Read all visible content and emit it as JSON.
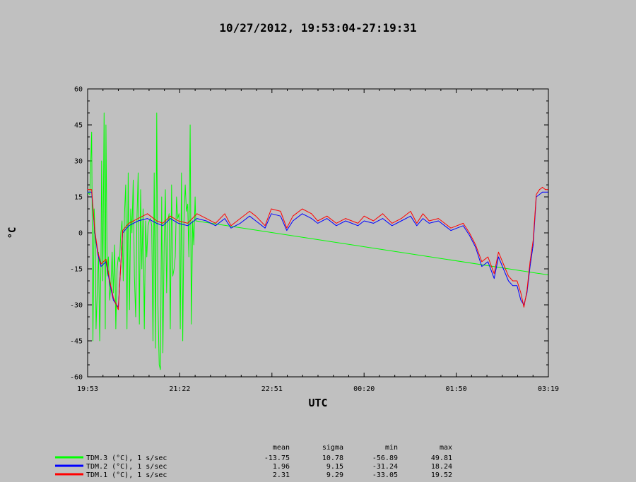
{
  "chart_data": {
    "type": "line",
    "title": "10/27/2012, 19:53:04-27:19:31",
    "xlabel": "UTC",
    "ylabel": "°C",
    "ylim": [
      -60,
      60
    ],
    "y_ticks": [
      "60",
      "45",
      "30",
      "15",
      "0",
      "-15",
      "-30",
      "-45",
      "-60"
    ],
    "x_ticks": [
      "19:53",
      "21:22",
      "22:51",
      "00:20",
      "01:50",
      "03:19"
    ],
    "x_range_hours": [
      19.8844,
      27.3253
    ],
    "grid": false,
    "colors": {
      "TDM.3": "#00ff00",
      "TDM.2": "#0000ff",
      "TDM.1": "#ff0000"
    },
    "stats_headers": [
      "mean",
      "sigma",
      "min",
      "max"
    ],
    "series": [
      {
        "name": "TDM.3 (°C), 1 s/sec",
        "key": "TDM.3",
        "stats": [
          "-13.75",
          "10.78",
          "-56.89",
          "49.81"
        ],
        "x": [
          19.88,
          19.92,
          19.95,
          19.97,
          19.99,
          20.01,
          20.02,
          20.04,
          20.06,
          20.08,
          20.1,
          20.11,
          20.13,
          20.15,
          20.17,
          20.18,
          20.2,
          20.22,
          20.24,
          20.26,
          20.28,
          20.3,
          20.32,
          20.34,
          20.36,
          20.38,
          20.4,
          20.42,
          20.44,
          20.46,
          20.48,
          20.5,
          20.52,
          20.54,
          20.56,
          20.58,
          20.6,
          20.62,
          20.64,
          20.66,
          20.68,
          20.7,
          20.72,
          20.74,
          20.76,
          20.78,
          20.8,
          20.82,
          20.84,
          20.86,
          20.88,
          20.9,
          20.92,
          20.94,
          20.96,
          20.98,
          21.0,
          21.02,
          21.04,
          21.06,
          21.08,
          21.1,
          21.12,
          21.14,
          21.16,
          21.18,
          21.2,
          21.22,
          21.24,
          21.26,
          21.28,
          21.3,
          21.32,
          21.34,
          21.36,
          21.38,
          21.4,
          21.42,
          21.44,
          21.46,
          21.48,
          21.5,
          21.52,
          21.54,
          21.56,
          21.58,
          21.6,
          21.62,
          21.63,
          27.32
        ],
        "y": [
          17,
          16,
          42,
          -45,
          10,
          -5,
          -40,
          -25,
          -8,
          -45,
          -12,
          30,
          -20,
          50,
          -40,
          45,
          -18,
          -10,
          -28,
          -22,
          -8,
          -25,
          -5,
          -40,
          -15,
          -10,
          -12,
          0,
          5,
          -20,
          8,
          20,
          -40,
          25,
          -32,
          10,
          0,
          22,
          -18,
          -35,
          5,
          25,
          -38,
          18,
          -15,
          10,
          -40,
          5,
          -10,
          3,
          5,
          6,
          3,
          -45,
          25,
          -48,
          50,
          -30,
          -55,
          -57,
          15,
          -50,
          -5,
          18,
          -25,
          5,
          8,
          -40,
          20,
          -18,
          -15,
          -10,
          15,
          6,
          8,
          -40,
          25,
          -45,
          5,
          20,
          9,
          12,
          -10,
          45,
          -38,
          5,
          -5,
          15,
          5,
          -17.5
        ],
        "values": [
          17,
          16,
          42,
          -45,
          10,
          -5,
          -40,
          -25,
          -8,
          -45,
          -12,
          30,
          -20,
          50,
          -40,
          45,
          -18,
          -10,
          -28,
          -22,
          -8,
          -25,
          -5,
          -40,
          -15,
          -10,
          -12,
          0,
          5,
          -20,
          8,
          20,
          -40,
          25,
          -32,
          10,
          0,
          22,
          -18,
          -35,
          5,
          25,
          -38,
          18,
          -15,
          10,
          -40,
          5,
          -10,
          3,
          5,
          6,
          3,
          -45,
          25,
          -48,
          50,
          -30,
          -55,
          -57,
          15,
          -50,
          -5,
          18,
          -25,
          5,
          8,
          -40,
          20,
          -18,
          -15,
          -10,
          15,
          6,
          8,
          -40,
          25,
          -45,
          5,
          20,
          9,
          12,
          -10,
          45,
          -38,
          5,
          -5,
          15,
          5,
          -17.5
        ]
      },
      {
        "name": "TDM.2 (°C), 1 s/sec",
        "key": "TDM.2",
        "stats": [
          "1.96",
          "9.15",
          "-31.24",
          "18.24"
        ],
        "x": [
          19.88,
          19.95,
          20.0,
          20.05,
          20.1,
          20.18,
          20.25,
          20.3,
          20.38,
          20.45,
          20.55,
          20.7,
          20.85,
          21.0,
          21.1,
          21.22,
          21.35,
          21.5,
          21.65,
          21.8,
          21.95,
          22.1,
          22.2,
          22.35,
          22.5,
          22.6,
          22.75,
          22.85,
          23.0,
          23.1,
          23.2,
          23.35,
          23.5,
          23.6,
          23.75,
          23.9,
          24.05,
          24.15,
          24.25,
          24.35,
          24.5,
          24.65,
          24.8,
          24.95,
          25.1,
          25.2,
          25.3,
          25.4,
          25.55,
          25.65,
          25.75,
          25.85,
          25.95,
          26.05,
          26.15,
          26.25,
          26.35,
          26.45,
          26.52,
          26.6,
          26.68,
          26.75,
          26.82,
          26.88,
          26.93,
          26.98,
          27.03,
          27.08,
          27.13,
          27.18,
          27.23,
          27.28,
          27.32
        ],
        "y": [
          17,
          17,
          0,
          -9,
          -14,
          -12,
          -22,
          -28,
          -31,
          0,
          3,
          5,
          6,
          4,
          3,
          6,
          4,
          3,
          6,
          5,
          3,
          6,
          2,
          4,
          7,
          5,
          2,
          8,
          7,
          1,
          5,
          8,
          6,
          4,
          6,
          3,
          5,
          4,
          3,
          5,
          4,
          6,
          3,
          5,
          7,
          3,
          6,
          4,
          5,
          3,
          1,
          2,
          3,
          -1,
          -6,
          -14,
          -12,
          -19,
          -10,
          -15,
          -20,
          -22,
          -22,
          -28,
          -30,
          -25,
          -14,
          -5,
          15,
          16,
          17,
          17,
          17
        ],
        "values": [
          17,
          17,
          0,
          -9,
          -14,
          -12,
          -22,
          -28,
          -31,
          0,
          3,
          5,
          6,
          4,
          3,
          6,
          4,
          3,
          6,
          5,
          3,
          6,
          2,
          4,
          7,
          5,
          2,
          8,
          7,
          1,
          5,
          8,
          6,
          4,
          6,
          3,
          5,
          4,
          3,
          5,
          4,
          6,
          3,
          5,
          7,
          3,
          6,
          4,
          5,
          3,
          1,
          2,
          3,
          -1,
          -6,
          -14,
          -12,
          -19,
          -10,
          -15,
          -20,
          -22,
          -22,
          -28,
          -30,
          -25,
          -14,
          -5,
          15,
          16,
          17,
          17,
          17
        ]
      },
      {
        "name": "TDM.1 (°C), 1 s/sec",
        "key": "TDM.1",
        "stats": [
          "2.31",
          "9.29",
          "-33.05",
          "19.52"
        ],
        "x": [
          19.88,
          19.95,
          20.0,
          20.05,
          20.1,
          20.18,
          20.25,
          20.3,
          20.38,
          20.45,
          20.55,
          20.7,
          20.85,
          21.0,
          21.1,
          21.22,
          21.35,
          21.5,
          21.65,
          21.8,
          21.95,
          22.1,
          22.2,
          22.35,
          22.5,
          22.6,
          22.75,
          22.85,
          23.0,
          23.1,
          23.2,
          23.35,
          23.5,
          23.6,
          23.75,
          23.9,
          24.05,
          24.15,
          24.25,
          24.35,
          24.5,
          24.65,
          24.8,
          24.95,
          25.1,
          25.2,
          25.3,
          25.4,
          25.55,
          25.65,
          25.75,
          25.85,
          25.95,
          26.05,
          26.15,
          26.25,
          26.35,
          26.45,
          26.52,
          26.6,
          26.68,
          26.75,
          26.82,
          26.88,
          26.93,
          26.98,
          27.03,
          27.08,
          27.13,
          27.18,
          27.23,
          27.28,
          27.32
        ],
        "y": [
          18,
          18,
          1,
          -8,
          -13,
          -11,
          -21,
          -27,
          -32,
          1,
          4,
          6,
          8,
          5,
          4,
          7,
          5,
          4,
          8,
          6,
          4,
          8,
          3,
          6,
          9,
          7,
          3,
          10,
          9,
          2,
          7,
          10,
          8,
          5,
          7,
          4,
          6,
          5,
          4,
          7,
          5,
          8,
          4,
          6,
          9,
          4,
          8,
          5,
          6,
          4,
          2,
          3,
          4,
          0,
          -5,
          -12,
          -10,
          -17,
          -8,
          -13,
          -18,
          -20,
          -20,
          -25,
          -31,
          -24,
          -12,
          -3,
          16,
          18,
          19,
          18,
          18
        ],
        "values": [
          18,
          18,
          1,
          -8,
          -13,
          -11,
          -21,
          -27,
          -32,
          1,
          4,
          6,
          8,
          5,
          4,
          7,
          5,
          4,
          8,
          6,
          4,
          8,
          3,
          6,
          9,
          7,
          3,
          10,
          9,
          2,
          7,
          10,
          8,
          5,
          7,
          4,
          6,
          5,
          4,
          7,
          5,
          8,
          4,
          6,
          9,
          4,
          8,
          5,
          6,
          4,
          2,
          3,
          4,
          0,
          -5,
          -12,
          -10,
          -17,
          -8,
          -13,
          -18,
          -20,
          -20,
          -25,
          -31,
          -24,
          -12,
          -3,
          16,
          18,
          19,
          18,
          18
        ]
      }
    ]
  }
}
